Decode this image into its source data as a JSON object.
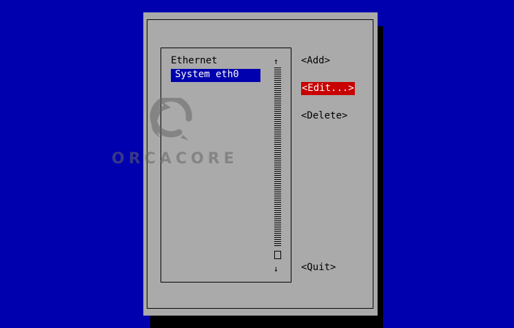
{
  "listbox": {
    "heading": "Ethernet",
    "items": [
      {
        "label": "System eth0",
        "selected": true
      }
    ]
  },
  "scrollbar": {
    "up_arrow": "↑",
    "down_arrow": "↓"
  },
  "buttons": {
    "add": "<Add>",
    "edit": "<Edit...>",
    "delete": "<Delete>",
    "quit": "<Quit>"
  },
  "watermark": {
    "text": "ORCACORE",
    "icon": "orcacore-logo-icon"
  },
  "colors": {
    "screen_bg": "#0000ae",
    "dialog_bg": "#aaaaaa",
    "selection_bg": "#0000ae",
    "focused_button_bg": "#c80000"
  }
}
